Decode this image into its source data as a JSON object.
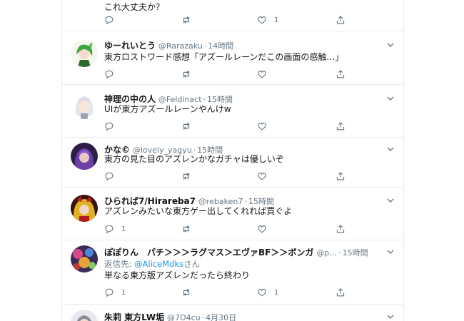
{
  "top": {
    "text": "これ大丈夫か？",
    "like_count": "1"
  },
  "tweets": [
    {
      "name": "ゆーれいとう",
      "handle": "@Rarazaku",
      "time": "14時間",
      "text": "東方ロストワード感想「アズールレーンだこの画面の感触…」",
      "reply_count": "",
      "like_count": ""
    },
    {
      "name": "神理の中の人",
      "handle": "@Feldinact",
      "time": "15時間",
      "text": "UIが東方アズールレーンやんけw",
      "reply_count": "",
      "like_count": ""
    },
    {
      "name": "かな©",
      "handle": "@lovely_yagyu",
      "time": "15時間",
      "text": "東方の見た目のアズレンかなガチャは優しいぞ",
      "reply_count": "",
      "like_count": ""
    },
    {
      "name": "ひられば7/Hirareba7",
      "handle": "@rebaken7",
      "time": "15時間",
      "text": "アズレンみたいな東方ゲー出してくれれば買ぐよ",
      "reply_count": "1",
      "like_count": ""
    },
    {
      "name": "ぽぽりん　パチ＞＞＞ラグマス＞エヴァBF＞＞ボンガ",
      "handle": "@p…",
      "time": "15時間",
      "reply_prefix": "返信先: ",
      "reply_mention": "@AliceMdks",
      "reply_suffix": "さん",
      "text": "単なる東方版アズレンだったら終わり",
      "reply_count": "1",
      "like_count": "1"
    },
    {
      "name": "朱莉 東方LW垢",
      "handle": "@7O4cu",
      "time": "4月30日"
    }
  ]
}
